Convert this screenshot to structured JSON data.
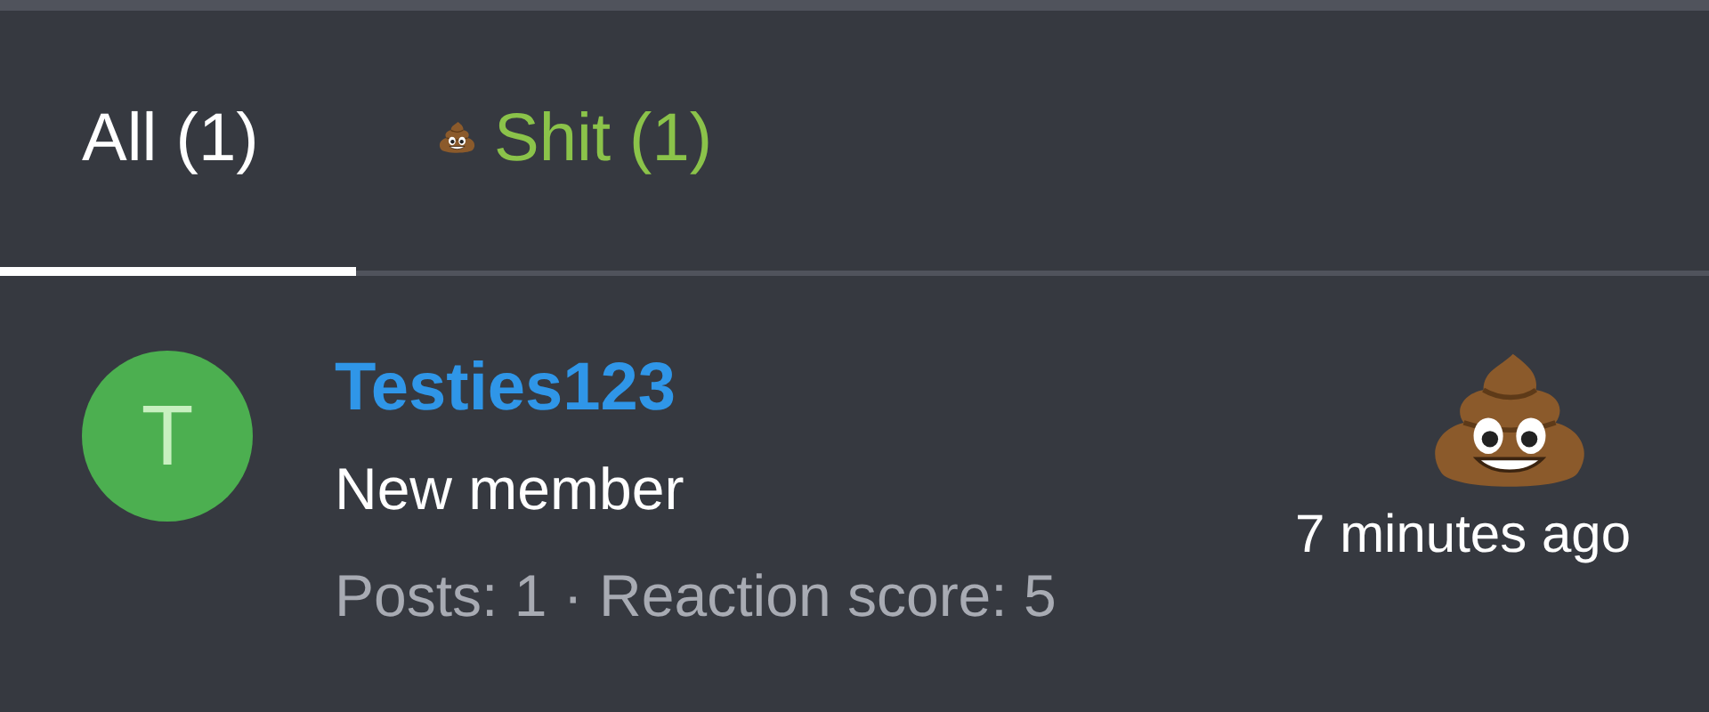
{
  "tabs": [
    {
      "label": "All (1)",
      "selected": true,
      "kind": "all"
    },
    {
      "label": "Shit (1)",
      "selected": false,
      "kind": "reaction"
    }
  ],
  "reactions": [
    {
      "avatar_letter": "T",
      "username": "Testies123",
      "title": "New member",
      "stats": "Posts: 1 · Reaction score: 5",
      "time": "7 minutes ago"
    }
  ]
}
